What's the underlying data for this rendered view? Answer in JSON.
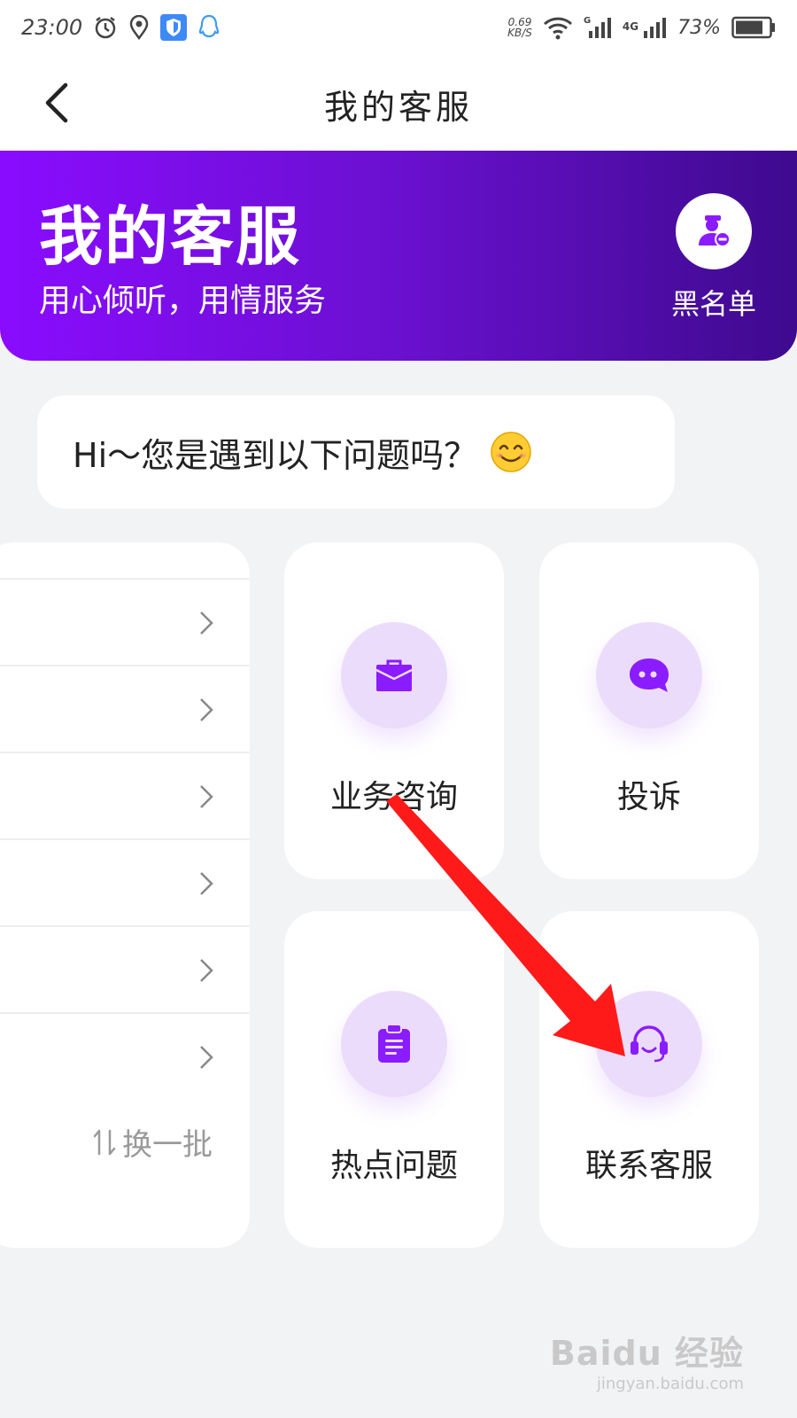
{
  "status_bar": {
    "time": "23:00",
    "net_speed_value": "0.69",
    "net_speed_unit": "KB/S",
    "network_type": "4G",
    "battery_percent": "73%",
    "icons": [
      "alarm-icon",
      "location-icon",
      "shield-app-icon",
      "qq-icon",
      "wifi-icon",
      "signal-icon",
      "battery-icon"
    ]
  },
  "header": {
    "title": "我的客服"
  },
  "hero": {
    "title": "我的客服",
    "subtitle": "用心倾听，用情服务",
    "blacklist_label": "黑名单"
  },
  "greeting": {
    "text": "Hi～您是遇到以下问题吗？"
  },
  "question_list": {
    "refresh_label": "换一批",
    "row_count": 6
  },
  "tiles": [
    {
      "label": "业务咨询",
      "icon": "briefcase-icon"
    },
    {
      "label": "投诉",
      "icon": "chat-bubble-icon"
    },
    {
      "label": "热点问题",
      "icon": "clipboard-icon"
    },
    {
      "label": "联系客服",
      "icon": "headset-icon"
    }
  ],
  "colors": {
    "accent": "#8a0cff",
    "accent_dark": "#3e0a8e",
    "icon_purple": "#8a1cff",
    "icon_bg": "#ecdcfc",
    "annotation_arrow": "#ff1a1a"
  },
  "watermark": {
    "brand": "Baidu 经验",
    "url": "jingyan.baidu.com"
  }
}
